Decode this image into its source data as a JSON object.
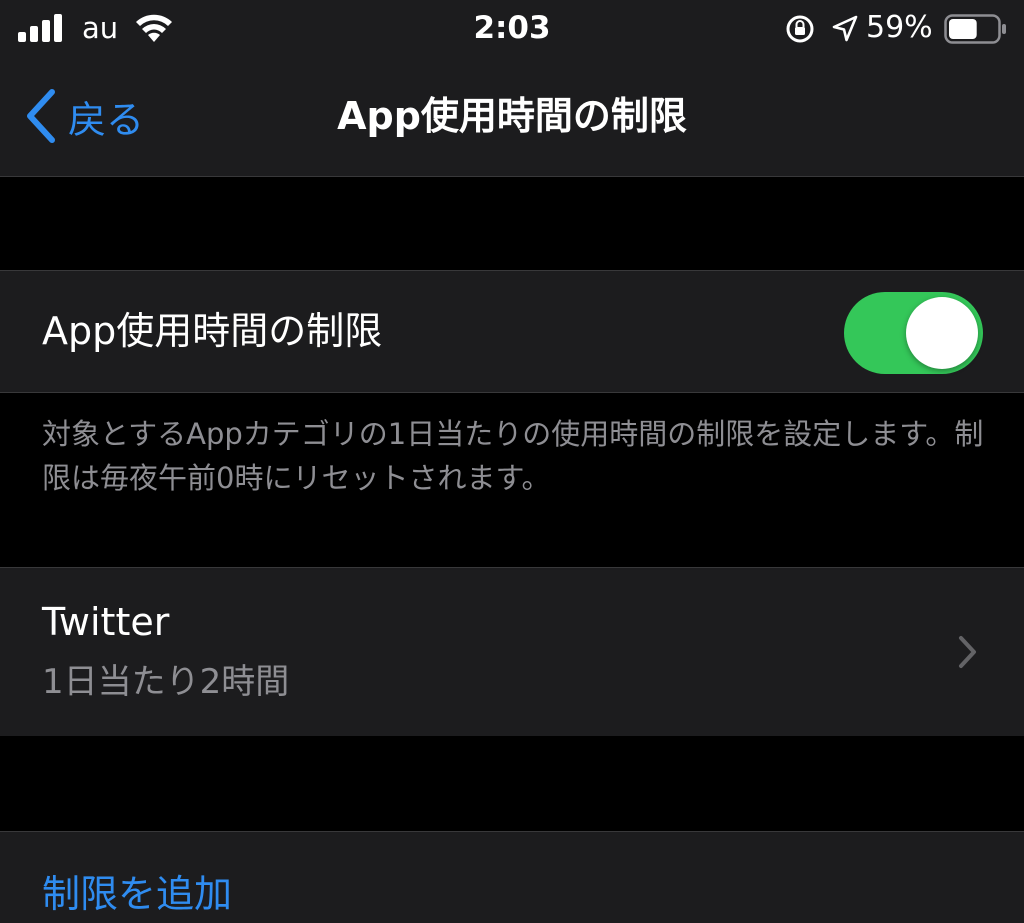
{
  "status_bar": {
    "carrier": "au",
    "time": "2:03",
    "battery_percent": "59%",
    "battery_level": 0.59,
    "icons": [
      "signal-icon",
      "wifi-icon",
      "orientation-lock-icon",
      "location-icon",
      "battery-icon"
    ]
  },
  "nav": {
    "back_label": "戻る",
    "title": "App使用時間の制限"
  },
  "toggle_row": {
    "label": "App使用時間の制限",
    "enabled": true
  },
  "description": "対象とするAppカテゴリの1日当たりの使用時間の制限を設定します。制限は毎夜午前0時にリセットされます。",
  "limits": [
    {
      "name": "Twitter",
      "detail": "1日当たり2時間"
    }
  ],
  "add_limit_label": "制限を追加",
  "colors": {
    "accent": "#2f8cf0",
    "toggle_on": "#34c759",
    "background": "#000000",
    "cell": "#1c1c1e",
    "secondary_text": "#8e8e93"
  }
}
